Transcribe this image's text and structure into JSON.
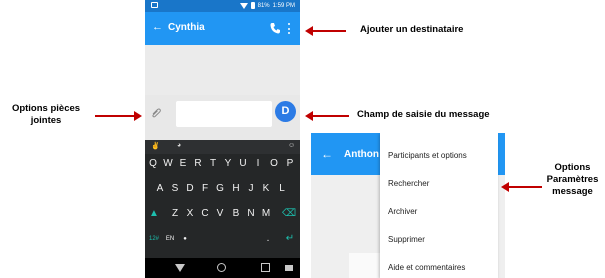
{
  "phone1": {
    "status": {
      "battery": "81%",
      "time": "1:59 PM"
    },
    "contact_name": "Cynthia",
    "send_avatar_letter": "D",
    "keyboard": {
      "row1": [
        "Q",
        "W",
        "E",
        "R",
        "T",
        "Y",
        "U",
        "I",
        "O",
        "P"
      ],
      "row2": [
        "A",
        "S",
        "D",
        "F",
        "G",
        "H",
        "J",
        "K",
        "L"
      ],
      "row3": [
        "Z",
        "X",
        "C",
        "V",
        "B",
        "N",
        "M"
      ],
      "switch_label": "12#",
      "lang_label": "EN",
      "punctuation": "."
    }
  },
  "phone2": {
    "contact_name": "Anthon",
    "menu_items": [
      "Participants et options",
      "Rechercher",
      "Archiver",
      "Supprimer",
      "Aide et commentaires"
    ]
  },
  "annotations": {
    "add_recipient": "Ajouter un destinataire",
    "attachment_options": [
      "Options pièces",
      "jointes"
    ],
    "message_input": "Champ de saisie du message",
    "message_settings": [
      "Options",
      "Paramètres",
      "message"
    ]
  },
  "colors": {
    "appbar": "#2196f3",
    "statusbar": "#1976c9",
    "arrow": "#c00000",
    "keyboard_bg": "#252728",
    "send_button": "#2c7be5"
  }
}
